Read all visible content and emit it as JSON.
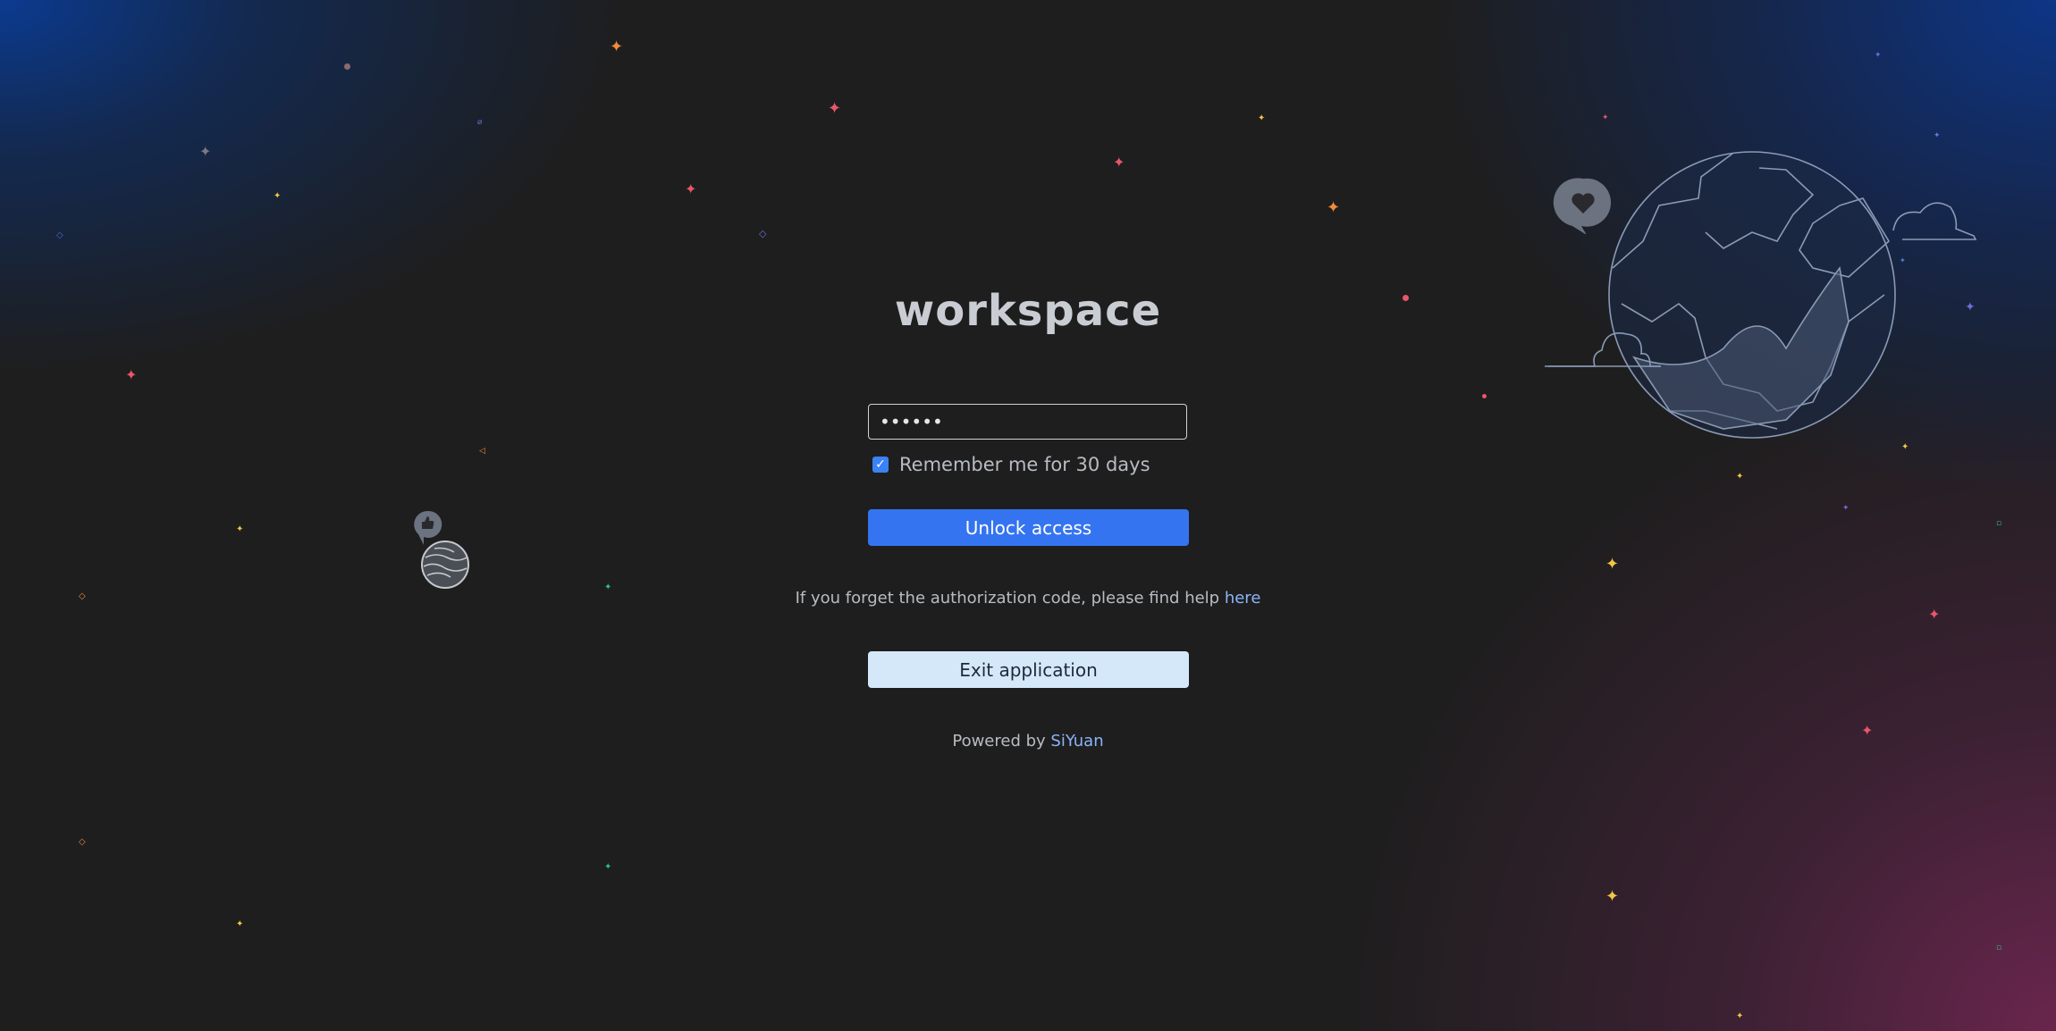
{
  "page": {
    "title": "workspace",
    "password": {
      "value": "••••••"
    },
    "remember": {
      "label": "Remember me for 30 days",
      "checked": true
    },
    "unlock_button": "Unlock access",
    "help": {
      "text": "If you forget the authorization code, please find help ",
      "link": "here"
    },
    "exit_button": "Exit application",
    "powered": {
      "text": "Powered by ",
      "link": "SiYuan"
    }
  },
  "icons": {
    "checkbox": "checkmark-icon",
    "globe": "globe-illustration-icon",
    "heart_bubble": "heart-bubble-icon",
    "small_planet": "planet-icon",
    "thumb_bubble": "thumbs-up-bubble-icon",
    "sparkle": "sparkle-icon"
  },
  "colors": {
    "background": "#1e1e1e",
    "primary_button": "#3574f0",
    "secondary_button": "#d5e8fa",
    "link": "#8bb4f8",
    "text": "#b8bcc2"
  }
}
